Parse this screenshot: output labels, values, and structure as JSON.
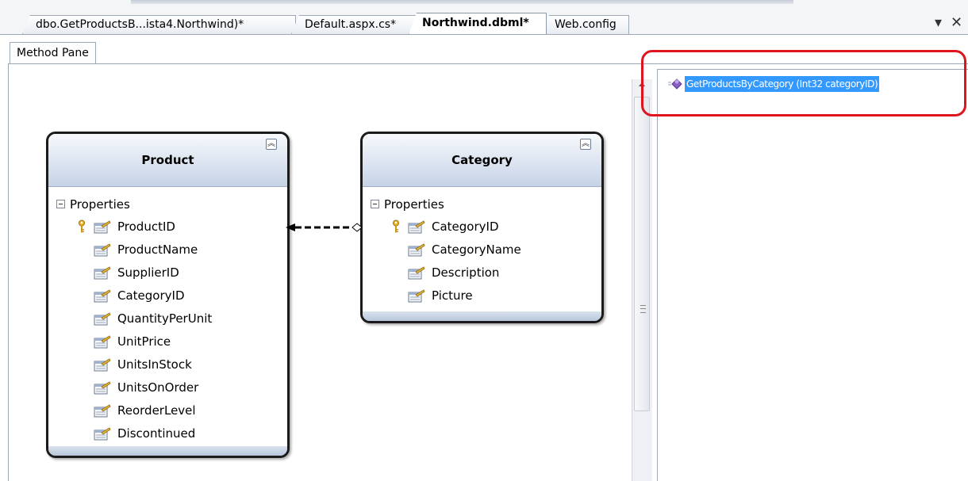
{
  "tabs": [
    {
      "label": "dbo.GetProductsB...ista4.Northwind)*",
      "active": false
    },
    {
      "label": "Default.aspx.cs*",
      "active": false
    },
    {
      "label": "Northwind.dbml*",
      "active": true
    },
    {
      "label": "Web.config",
      "active": false
    }
  ],
  "window_controls": {
    "dropdown_glyph": "▾",
    "close_glyph": "✕"
  },
  "method_pane": {
    "label": "Method Pane",
    "items": [
      {
        "text": "GetProductsByCategory (Int32 categoryID)",
        "selected": true,
        "icon": "method-icon"
      }
    ]
  },
  "entities": {
    "product": {
      "title": "Product",
      "section": "Properties",
      "properties": [
        {
          "name": "ProductID",
          "key": true
        },
        {
          "name": "ProductName",
          "key": false
        },
        {
          "name": "SupplierID",
          "key": false
        },
        {
          "name": "CategoryID",
          "key": false
        },
        {
          "name": "QuantityPerUnit",
          "key": false
        },
        {
          "name": "UnitPrice",
          "key": false
        },
        {
          "name": "UnitsInStock",
          "key": false
        },
        {
          "name": "UnitsOnOrder",
          "key": false
        },
        {
          "name": "ReorderLevel",
          "key": false
        },
        {
          "name": "Discontinued",
          "key": false
        }
      ]
    },
    "category": {
      "title": "Category",
      "section": "Properties",
      "properties": [
        {
          "name": "CategoryID",
          "key": true
        },
        {
          "name": "CategoryName",
          "key": false
        },
        {
          "name": "Description",
          "key": false
        },
        {
          "name": "Picture",
          "key": false
        }
      ]
    }
  },
  "colors": {
    "selection": "#3399ff",
    "highlight_ring": "#e0141c",
    "entity_header": "#c6d3e6"
  }
}
